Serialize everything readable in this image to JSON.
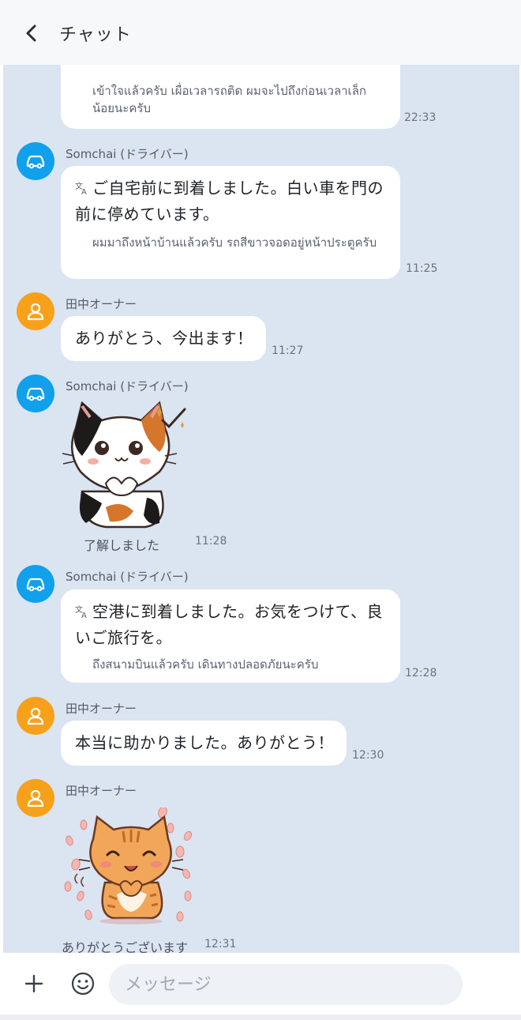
{
  "header": {
    "title": "チャット"
  },
  "messages": {
    "m0": {
      "sub": "เข้าใจแล้วครับ เผื่อเวลารถติด ผมจะไปถึงก่อนเวลาเล็กน้อยนะครับ",
      "time": "22:33"
    },
    "m1": {
      "sender": "Somchai (ドライバー)",
      "text": "ご自宅前に到着しました。白い車を門の前に停めています。",
      "sub": "ผมมาถึงหน้าบ้านแล้วครับ รถสีขาวจอดอยู่หน้าประตูครับ",
      "time": "11:25"
    },
    "m2": {
      "sender": "田中オーナー",
      "text": "ありがとう、今出ます！",
      "time": "11:27"
    },
    "m3": {
      "sender": "Somchai (ドライバー)",
      "caption": "了解しました",
      "time": "11:28"
    },
    "m4": {
      "sender": "Somchai (ドライバー)",
      "text": "空港に到着しました。お気をつけて、良いご旅行を。",
      "sub": "ถึงสนามบินแล้วครับ เดินทางปลอดภัยนะครับ",
      "time": "12:28"
    },
    "m5": {
      "sender": "田中オーナー",
      "text": "本当に助かりました。ありがとう！",
      "time": "12:30"
    },
    "m6": {
      "sender": "田中オーナー",
      "caption": "ありがとうございます",
      "time": "12:31"
    }
  },
  "composer": {
    "placeholder": "メッセージ"
  },
  "colors": {
    "driver_avatar": "#10a0ec",
    "owner_avatar": "#f7a11a",
    "chat_bg": "#dbe4f1"
  },
  "icons": {
    "back": "chevron-left-icon",
    "driver": "car-icon",
    "owner": "person-icon",
    "translate": "translate-icon",
    "plus": "plus-icon",
    "emoji": "smiley-icon"
  }
}
